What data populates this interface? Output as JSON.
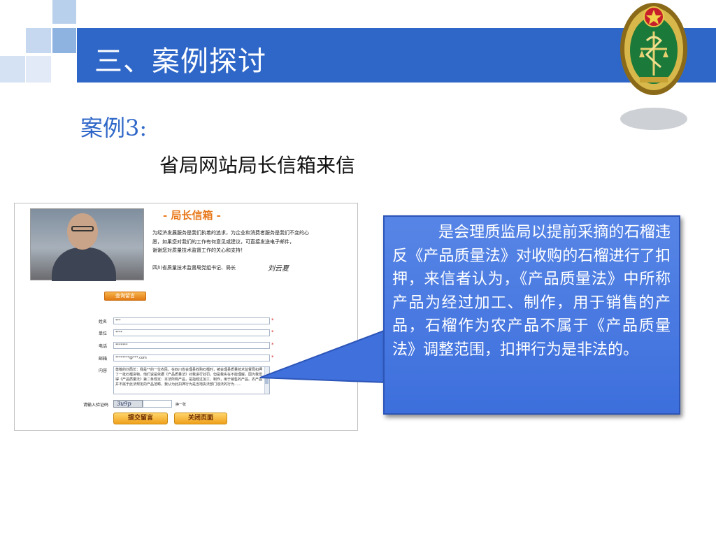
{
  "slide": {
    "title": "三、案例探讨",
    "case_label": "案例3:",
    "subtitle": "省局网站局长信箱来信",
    "colors": {
      "title_bar": "#2f67c8",
      "callout": "#4a7be2",
      "case_label": "#2f67c8"
    }
  },
  "mailbox": {
    "header": "- 局长信箱 -",
    "intro_lines": [
      "为经济发展服务是我们执着的追求，为企业和消费者服务是我们不变的心",
      "愿，如果您对我们的工作有何意见或建议，可直接发送电子邮件，",
      "谢谢您对质量技术监督工作的关心和支持！"
    ],
    "signature": "四川省质量技术监督局党组书记、局长",
    "signature_name": "刘云夏",
    "query_button": "查询留言",
    "fields": [
      {
        "label": "姓名",
        "value": "***"
      },
      {
        "label": "单位",
        "value": "****"
      },
      {
        "label": "电话",
        "value": "*******"
      },
      {
        "label": "邮箱",
        "value": "********@***.com"
      }
    ],
    "content_label": "内容",
    "content_value": "尊敬的刘局长：我是**的一位农民，在四川省会理县收购石榴时，被会理县质量技术监督局扣押了一批石榴货物，他们说是依据《产品质量法》对我进行处罚，但是我实在不能理解，因为我觉得《产品质量法》第二条规定：本法所称产品，是指经过加工、制作，用于销售的产品。农产品并不属于此法规定的产品范畴，我认为此扣押行为是当地执法部门违法的行为……",
    "captcha_label": "请输入验证码",
    "captcha_code": "3u9p",
    "captcha_refresh": "换一张",
    "submit_button": "提交留言",
    "close_button": "关闭页面"
  },
  "callout": {
    "text": "是会理质监局以提前采摘的石榴违反《产品质量法》对收购的石榴进行了扣押，来信者认为，《产品质量法》中所称产品为经过加工、制作，用于销售的产品，石榴作为农产品不属于《产品质量法》调整范围，扣押行为是非法的。"
  }
}
